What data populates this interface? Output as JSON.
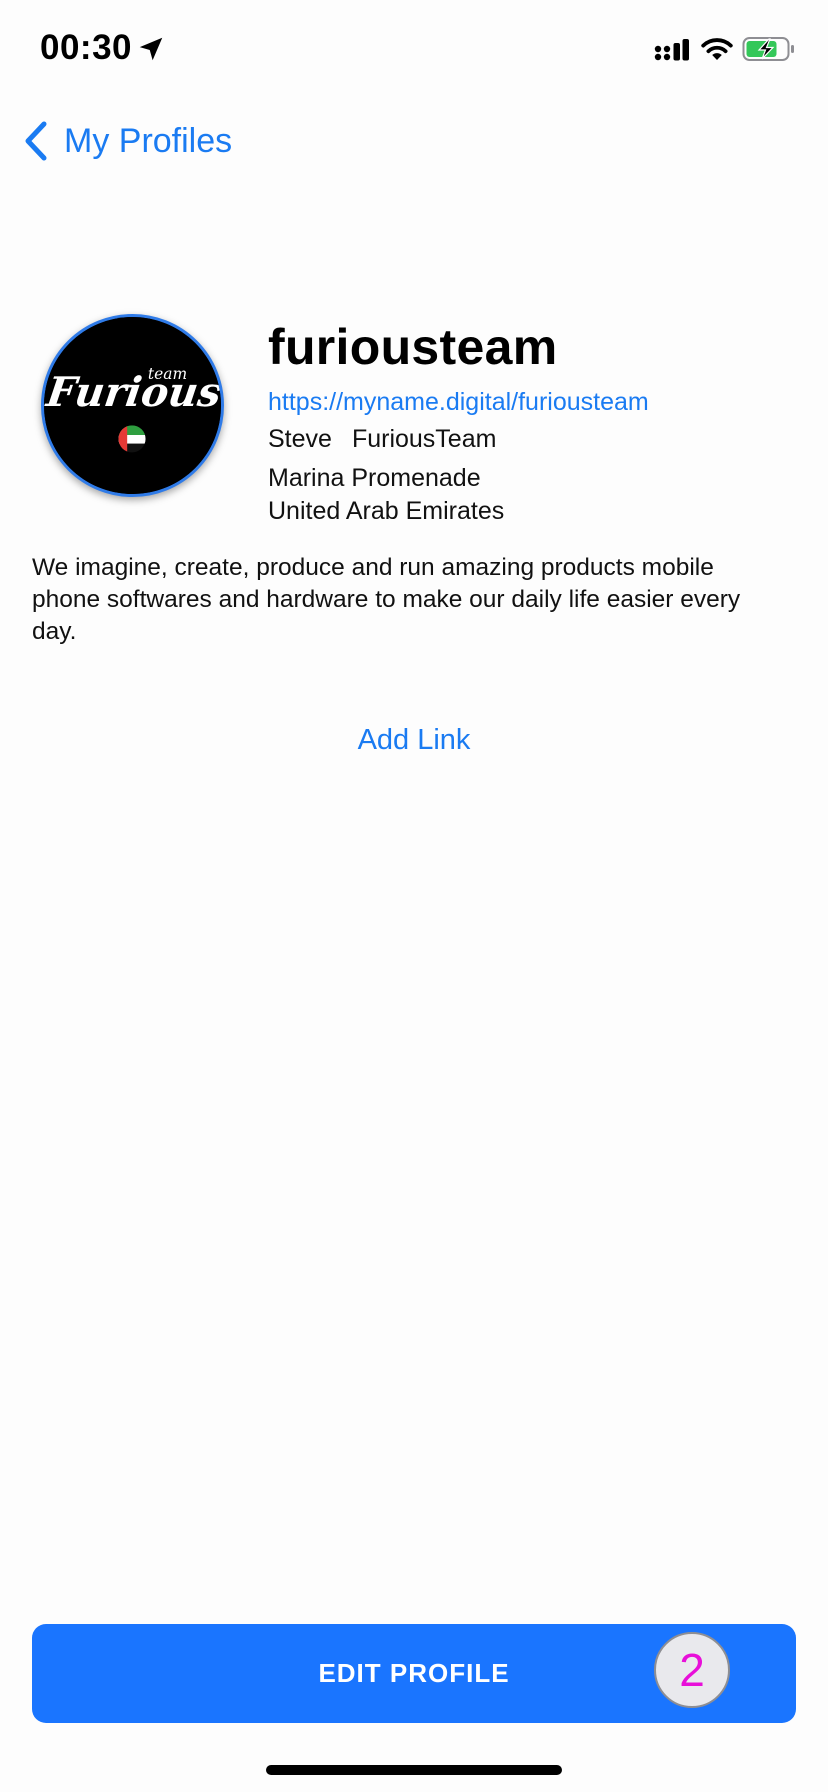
{
  "status_bar": {
    "time": "00:30",
    "icons": [
      "location-arrow-icon",
      "cellular-signal-icon",
      "wifi-icon",
      "battery-charging-icon"
    ]
  },
  "nav": {
    "back_label": "My Profiles"
  },
  "avatar": {
    "logo_text": "Furious",
    "logo_subtext": "team",
    "icon": "uae-flag-icon"
  },
  "profile": {
    "username": "furiousteam",
    "url": "https://myname.digital/furiousteam",
    "first_name": "Steve",
    "last_name": "FuriousTeam",
    "address_line1": "Marina Promenade",
    "address_line2": "United Arab Emirates",
    "bio": "We imagine, create, produce and run amazing products mobile phone softwares and hardware to make our daily life easier every day."
  },
  "links": {
    "add_label": "Add Link"
  },
  "footer": {
    "edit_label": "EDIT PROFILE",
    "badge": "2"
  },
  "colors": {
    "accent": "#1A7BF2",
    "button": "#1A75FF",
    "badge_text": "#E80FD9",
    "background": "#FDFDFD"
  }
}
